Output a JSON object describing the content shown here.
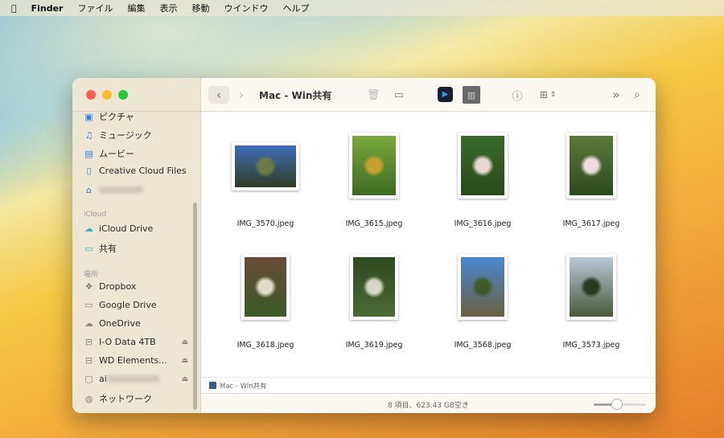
{
  "menubar": {
    "app": "Finder",
    "items": [
      "ファイル",
      "編集",
      "表示",
      "移動",
      "ウインドウ",
      "ヘルプ"
    ]
  },
  "window": {
    "title": "Mac - Win共有"
  },
  "sidebar": {
    "favorites": [
      {
        "label": "ピクチャ",
        "icon": "photo-icon"
      },
      {
        "label": "ミュージック",
        "icon": "music-icon"
      },
      {
        "label": "ムービー",
        "icon": "film-icon"
      },
      {
        "label": "Creative Cloud Files",
        "icon": "document-icon"
      }
    ],
    "icloud_header": "iCloud",
    "icloud": [
      {
        "label": "iCloud Drive"
      },
      {
        "label": "共有"
      }
    ],
    "locations_header": "場所",
    "locations": [
      {
        "label": "Dropbox"
      },
      {
        "label": "Google Drive"
      },
      {
        "label": "OneDrive"
      },
      {
        "label": "I-O Data 4TB"
      },
      {
        "label": "WD Elements..."
      },
      {
        "label": "ai"
      },
      {
        "label": "ネットワーク"
      }
    ]
  },
  "files": [
    {
      "name": "IMG_3570.jpeg",
      "colors": [
        "#3f6fb8",
        "#6b7a46",
        "#2e3a22"
      ]
    },
    {
      "name": "IMG_3615.jpeg",
      "colors": [
        "#7aa83c",
        "#c8a030",
        "#3e6a22"
      ]
    },
    {
      "name": "IMG_3616.jpeg",
      "colors": [
        "#3a6a2a",
        "#e8d8d0",
        "#2a4a1c"
      ]
    },
    {
      "name": "IMG_3617.jpeg",
      "colors": [
        "#5a7a3a",
        "#efdbe0",
        "#2d4a20"
      ]
    },
    {
      "name": "IMG_3618.jpeg",
      "colors": [
        "#6a4a3a",
        "#e0dcc8",
        "#3a5a28"
      ]
    },
    {
      "name": "IMG_3619.jpeg",
      "colors": [
        "#2e4a22",
        "#d8d8c8",
        "#4a6a32"
      ]
    },
    {
      "name": "IMG_3568.jpeg",
      "colors": [
        "#4a86d0",
        "#3e5a2a",
        "#6a6040"
      ]
    },
    {
      "name": "IMG_3573.jpeg",
      "colors": [
        "#b8c8d8",
        "#2a3a22",
        "#4a5a3a"
      ]
    }
  ],
  "pathbar": {
    "label": "Mac - Win共有"
  },
  "status": {
    "text": "8 項目、623.43 GB空き"
  },
  "zoom_slider": {
    "value": 0.45
  }
}
